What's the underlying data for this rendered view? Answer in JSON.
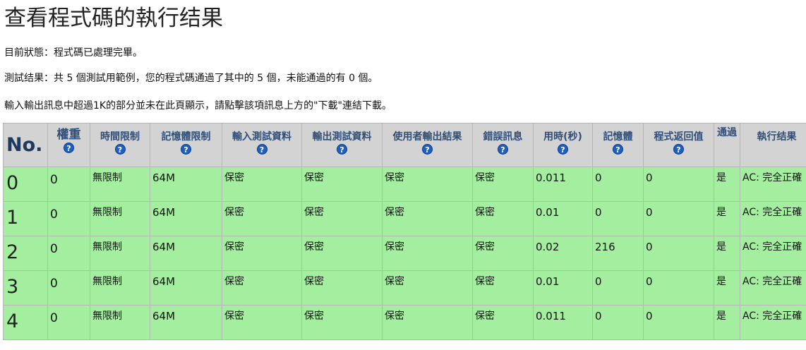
{
  "page": {
    "title": "查看程式碼的執行结果",
    "status_line": "目前狀態：程式碼已處理完畢。",
    "result_line": "測試结果：共 5 個測試用範例，您的程式碼通過了其中的 5 個，未能通過的有 0 個。",
    "note_line": "輸入輸出訊息中超過1K的部分並未在此頁顯示，請點擊該項訊息上方的\"下載\"連結下載。"
  },
  "table": {
    "help_icon_glyph": "?",
    "headers": {
      "no": "No.",
      "weight": "權重",
      "time_limit": "時間限制",
      "memory_limit": "記憶體限制",
      "input_data": "輸入測試資料",
      "output_data": "輸出測試資料",
      "user_output": "使用者輸出結果",
      "error_msg": "錯誤訊息",
      "time_used": "用時(秒)",
      "memory": "記憶體",
      "return_value": "程式返回值",
      "pass": "通過",
      "result": "執行结果"
    },
    "rows": [
      {
        "no": "0",
        "weight": "0",
        "time_limit": "無限制",
        "memory_limit": "64M",
        "input": "保密",
        "output": "保密",
        "user_output": "保密",
        "error": "保密",
        "time_used": "0.011",
        "memory": "0",
        "return_value": "0",
        "pass": "是",
        "result": "AC: 完全正確"
      },
      {
        "no": "1",
        "weight": "0",
        "time_limit": "無限制",
        "memory_limit": "64M",
        "input": "保密",
        "output": "保密",
        "user_output": "保密",
        "error": "保密",
        "time_used": "0.01",
        "memory": "0",
        "return_value": "0",
        "pass": "是",
        "result": "AC: 完全正確"
      },
      {
        "no": "2",
        "weight": "0",
        "time_limit": "無限制",
        "memory_limit": "64M",
        "input": "保密",
        "output": "保密",
        "user_output": "保密",
        "error": "保密",
        "time_used": "0.02",
        "memory": "216",
        "return_value": "0",
        "pass": "是",
        "result": "AC: 完全正確"
      },
      {
        "no": "3",
        "weight": "0",
        "time_limit": "無限制",
        "memory_limit": "64M",
        "input": "保密",
        "output": "保密",
        "user_output": "保密",
        "error": "保密",
        "time_used": "0.01",
        "memory": "0",
        "return_value": "0",
        "pass": "是",
        "result": "AC: 完全正確"
      },
      {
        "no": "4",
        "weight": "0",
        "time_limit": "無限制",
        "memory_limit": "64M",
        "input": "保密",
        "output": "保密",
        "user_output": "保密",
        "error": "保密",
        "time_used": "0.011",
        "memory": "0",
        "return_value": "0",
        "pass": "是",
        "result": "AC: 完全正確"
      }
    ]
  },
  "colors": {
    "header_bg": "#d3d3d3",
    "header_text": "#2f4f7a",
    "row_bg": "#a4ee9f",
    "help_icon_bg": "#1f5fbf"
  }
}
